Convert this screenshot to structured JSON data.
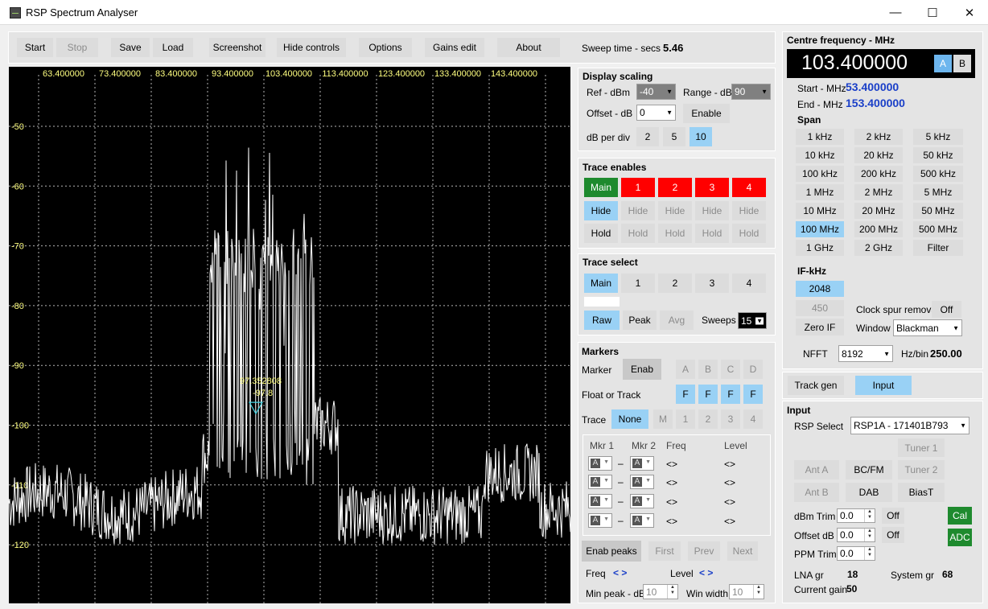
{
  "window": {
    "title": "RSP Spectrum Analyser",
    "minimize": "—",
    "maximize": "☐",
    "close": "✕"
  },
  "toolbar": {
    "start": "Start",
    "stop": "Stop",
    "save": "Save",
    "load": "Load",
    "screenshot": "Screenshot",
    "hide_controls": "Hide controls",
    "options": "Options",
    "gains_edit": "Gains edit",
    "about": "About",
    "sweep_label": "Sweep time - secs",
    "sweep_value": "5.46"
  },
  "plot": {
    "x_ticks": [
      "63.400000",
      "73.400000",
      "83.400000",
      "93.400000",
      "103.400000",
      "113.400000",
      "123.400000",
      "133.400000",
      "143.400000"
    ],
    "y_ticks": [
      "-50",
      "-60",
      "-70",
      "-80",
      "-90",
      "-100",
      "-110",
      "-120"
    ],
    "marker_text_1": "97.352808",
    "marker_text_2": "-97.8",
    "colors": {
      "background": "#000000",
      "trace": "#ffffff",
      "grid": "#b4b4b4",
      "ticks": "#ffff80",
      "marker": "#40d0e0"
    }
  },
  "display_scaling": {
    "title": "Display scaling",
    "ref_label": "Ref - dBm",
    "ref_value": "-40",
    "range_label": "Range - dB",
    "range_value": "90",
    "offset_label": "Offset - dB",
    "offset_value": "0",
    "enable": "Enable",
    "dbdiv_label": "dB per div",
    "dbdiv_options": [
      "2",
      "5",
      "10"
    ],
    "dbdiv_selected": "10"
  },
  "trace_enables": {
    "title": "Trace enables",
    "headers": [
      "Main",
      "1",
      "2",
      "3",
      "4"
    ],
    "hide": "Hide",
    "hold": "Hold"
  },
  "trace_select": {
    "title": "Trace select",
    "options": [
      "Main",
      "1",
      "2",
      "3",
      "4"
    ],
    "raw": "Raw",
    "peak": "Peak",
    "avg": "Avg",
    "sweeps_label": "Sweeps",
    "sweeps_value": "15"
  },
  "markers": {
    "title": "Markers",
    "marker_label": "Marker",
    "enab": "Enab",
    "letters": [
      "A",
      "B",
      "C",
      "D"
    ],
    "float_label": "Float or Track",
    "f": "F",
    "trace_label": "Trace",
    "none": "None",
    "m": "M",
    "nums": [
      "1",
      "2",
      "3",
      "4"
    ],
    "col_mkr1": "Mkr 1",
    "col_mkr2": "Mkr 2",
    "col_freq": "Freq",
    "col_level": "Level",
    "row_value": "A",
    "dash": "–",
    "arrows": "<>",
    "enab_peaks": "Enab peaks",
    "first": "First",
    "prev": "Prev",
    "next": "Next",
    "freq_label": "Freq",
    "freq_arrows": "< >",
    "level_label": "Level",
    "level_arrows": "< >",
    "minpeak_label": "Min peak - dB",
    "minpeak_value": "10",
    "winwidth_label": "Win width",
    "winwidth_value": "10"
  },
  "frequency": {
    "title": "Centre frequency - MHz",
    "centre": "103.400000",
    "a": "A",
    "b": "B",
    "start_label": "Start - MHz",
    "start_value": "53.400000",
    "end_label": "End - MHz",
    "end_value": "153.400000"
  },
  "span": {
    "title": "Span",
    "options": [
      "1 kHz",
      "2 kHz",
      "5 kHz",
      "10 kHz",
      "20 kHz",
      "50 kHz",
      "100 kHz",
      "200 kHz",
      "500 kHz",
      "1 MHz",
      "2 MHz",
      "5 MHz",
      "10 MHz",
      "20 MHz",
      "50 MHz",
      "100 MHz",
      "200 MHz",
      "500 MHz",
      "1 GHz",
      "2 GHz",
      "Filter"
    ],
    "selected": "100 MHz"
  },
  "if": {
    "title": "IF-kHz",
    "v2048": "2048",
    "v450": "450",
    "zero_if": "Zero IF",
    "clock_label": "Clock spur removal",
    "clock_value": "Off",
    "window_label": "Window",
    "window_value": "Blackman",
    "nfft_label": "NFFT",
    "nfft_value": "8192",
    "hzbin_label": "Hz/bin",
    "hzbin_value": "250.00"
  },
  "mode": {
    "track_gen": "Track gen",
    "input": "Input"
  },
  "input": {
    "title": "Input",
    "rsp_label": "RSP Select",
    "rsp_value": "RSP1A - 171401B793",
    "tuner1": "Tuner 1",
    "ant_a": "Ant A",
    "bcfm": "BC/FM",
    "tuner2": "Tuner 2",
    "ant_b": "Ant B",
    "dab": "DAB",
    "biast": "BiasT",
    "dbm_trim_label": "dBm Trim",
    "dbm_trim_value": "0.0",
    "off": "Off",
    "cal": "Cal",
    "offset_label": "Offset dB",
    "offset_value": "0.0",
    "adc": "ADC",
    "ppm_label": "PPM Trim",
    "ppm_value": "0.0",
    "lna_label": "LNA gr",
    "lna_value": "18",
    "sys_label": "System gr",
    "sys_value": "68",
    "cur_label": "Current gain",
    "cur_value": "50"
  }
}
